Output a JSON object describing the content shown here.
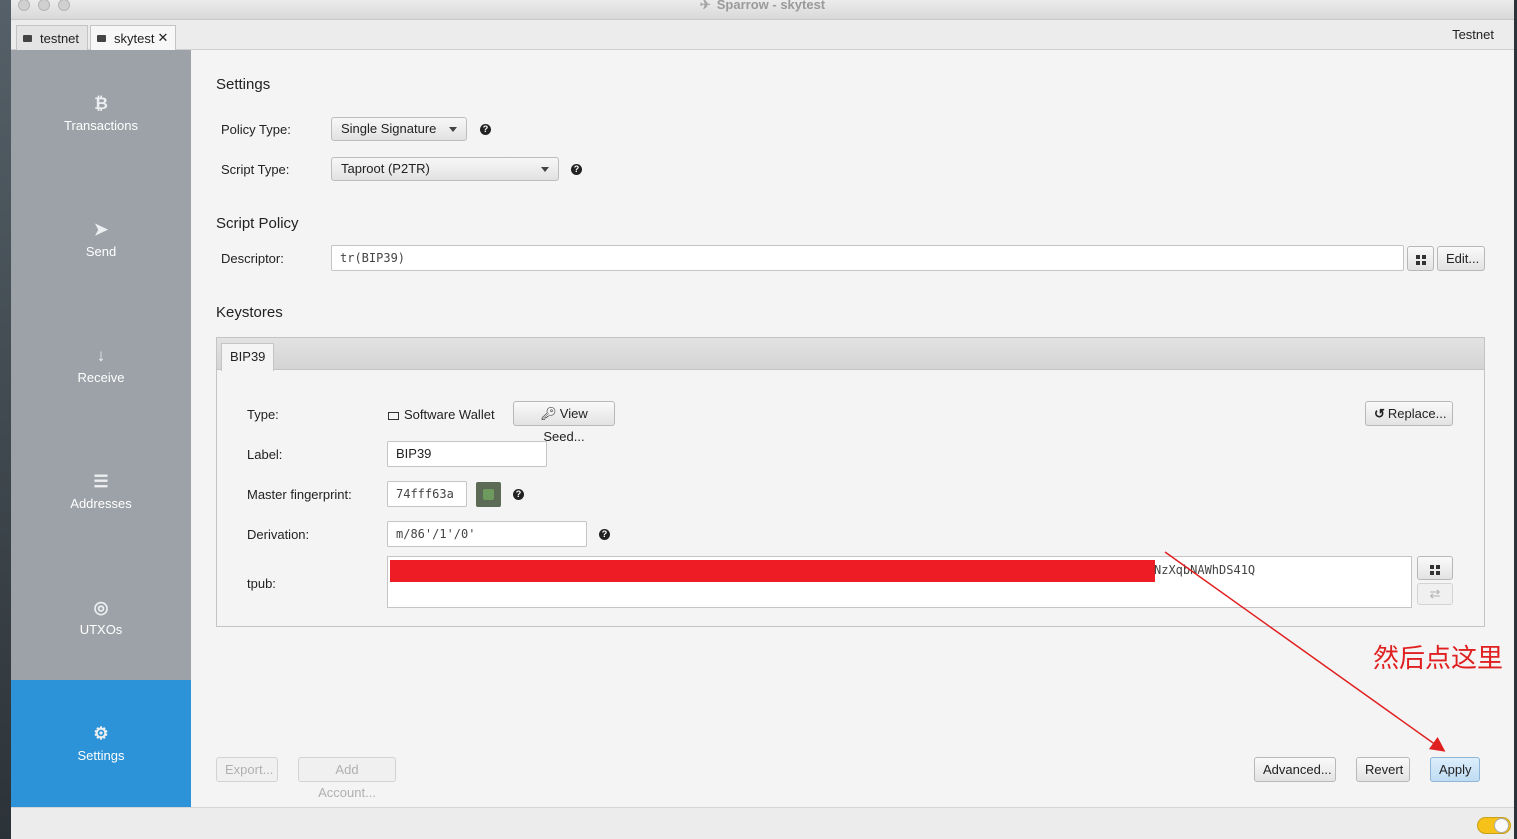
{
  "window": {
    "title": "Sparrow - skytest"
  },
  "tabs": [
    {
      "label": "testnet"
    },
    {
      "label": "skytest",
      "close": "✕"
    }
  ],
  "network": "Testnet",
  "sidebar": {
    "items": [
      {
        "label": "Transactions",
        "icon": "bitcoin-icon"
      },
      {
        "label": "Send",
        "icon": "paper-plane-icon"
      },
      {
        "label": "Receive",
        "icon": "arrow-down-icon"
      },
      {
        "label": "Addresses",
        "icon": "list-icon"
      },
      {
        "label": "UTXOs",
        "icon": "coins-icon"
      },
      {
        "label": "Settings",
        "icon": "gear-icon",
        "active": true
      }
    ]
  },
  "settings": {
    "title": "Settings",
    "policy_type_label": "Policy Type:",
    "policy_type_value": "Single Signature",
    "script_type_label": "Script Type:",
    "script_type_value": "Taproot (P2TR)"
  },
  "script_policy": {
    "title": "Script Policy",
    "descriptor_label": "Descriptor:",
    "descriptor_value": "tr(BIP39)",
    "edit_label": "Edit..."
  },
  "keystores": {
    "title": "Keystores",
    "tab_label": "BIP39",
    "type_label": "Type:",
    "type_value": "Software Wallet",
    "view_seed_label": "View Seed...",
    "replace_label": "Replace...",
    "label_label": "Label:",
    "label_value": "BIP39",
    "fingerprint_label": "Master fingerprint:",
    "fingerprint_value": "74fff63a",
    "derivation_label": "Derivation:",
    "derivation_value": "m/86'/1'/0'",
    "tpub_label": "tpub:",
    "tpub_visible_suffix": "NzXqbNAWhDS41Q"
  },
  "footer_buttons": {
    "export": "Export...",
    "add_account": "Add Account...",
    "advanced": "Advanced...",
    "revert": "Revert",
    "apply": "Apply"
  },
  "annotation": {
    "text": "然后点这里",
    "color": "#e02020"
  },
  "colors": {
    "accent": "#2c93d8",
    "sidebar": "#9ca2a8",
    "redaction": "#ee1c25",
    "toggle": "#f6c21a"
  }
}
